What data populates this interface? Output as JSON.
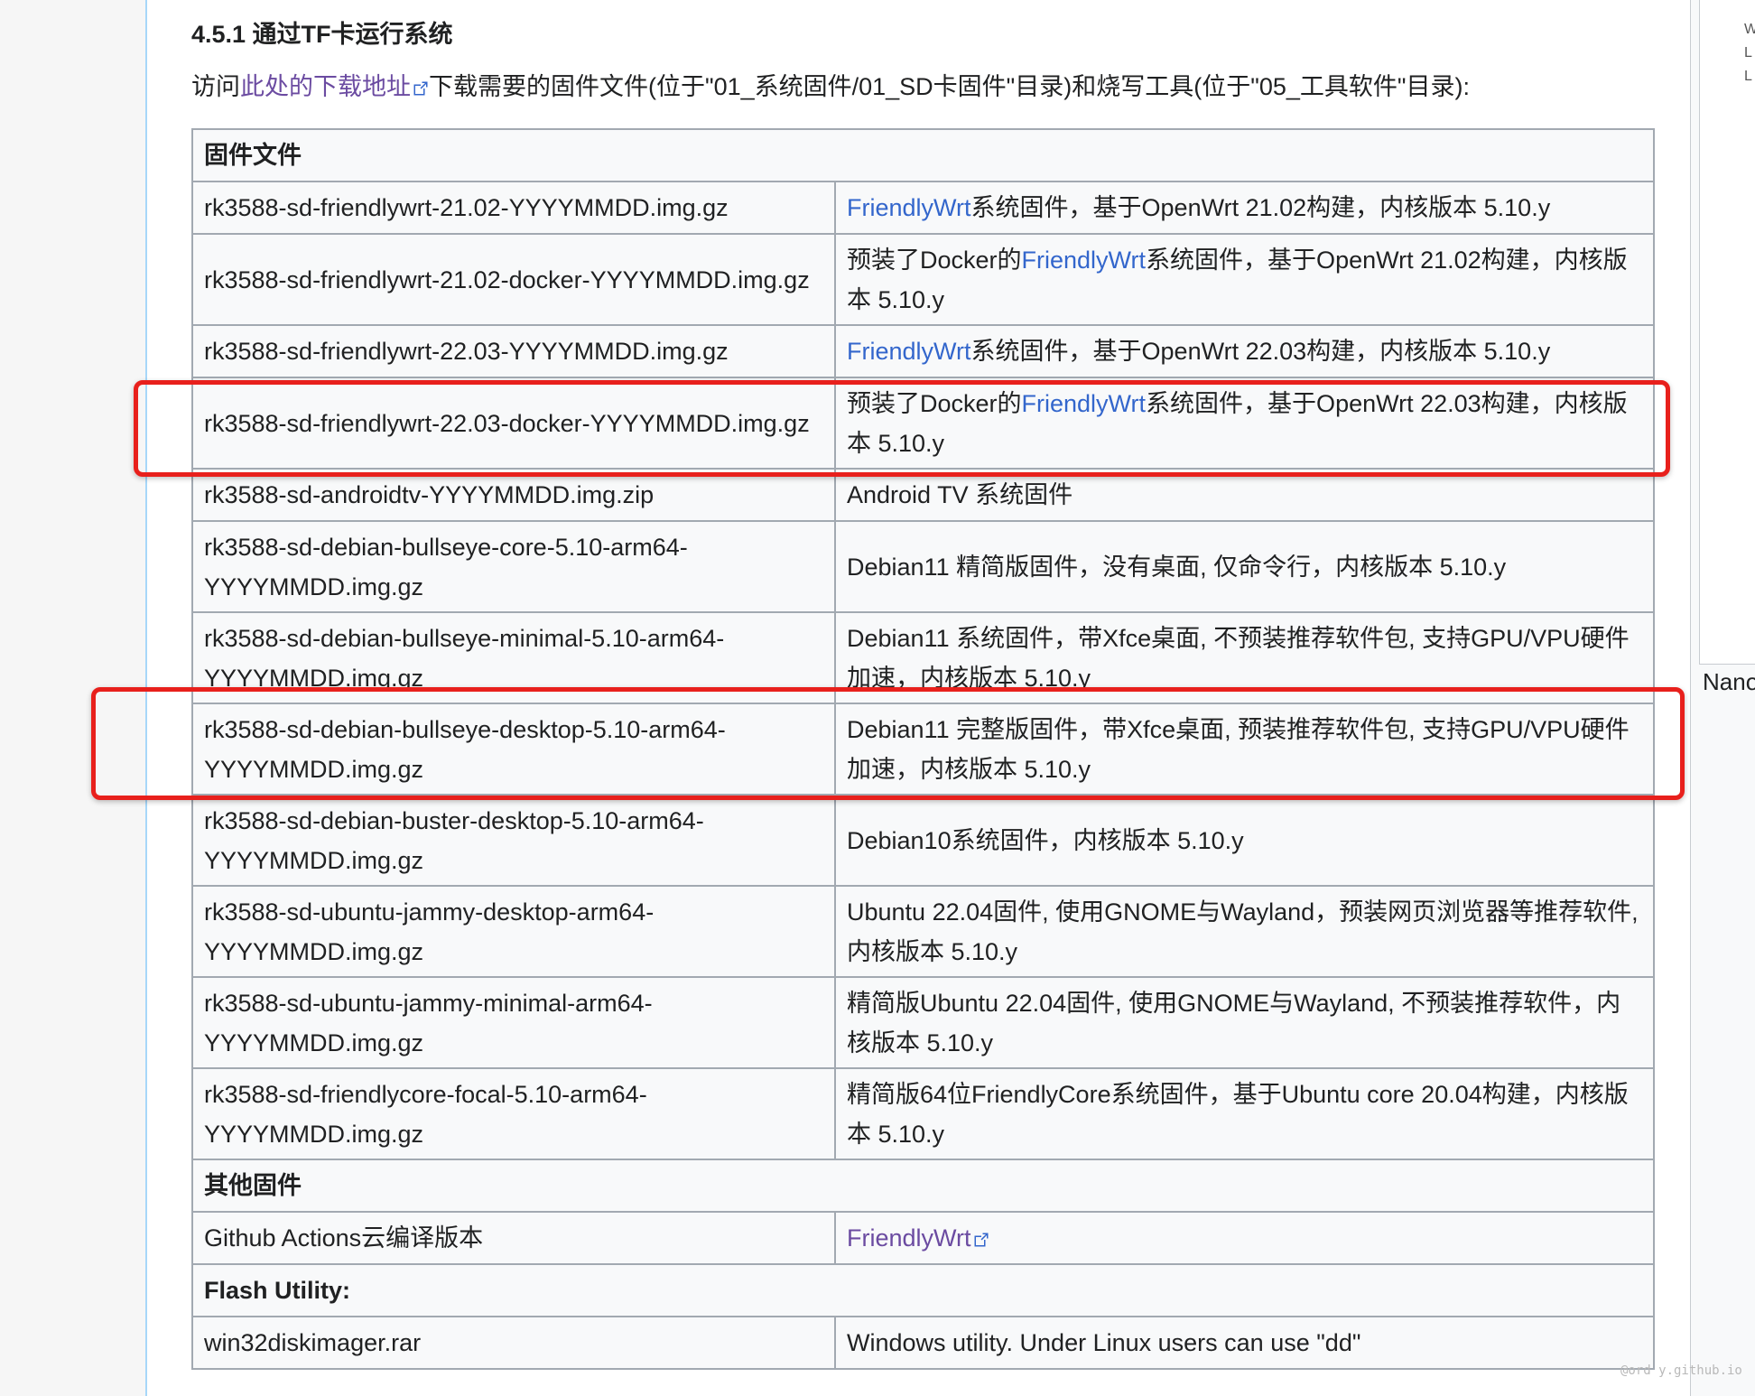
{
  "heading": "4.5.1 通过TF卡运行系统",
  "intro": {
    "prefix": "访问",
    "link": "此处的下载地址",
    "suffix": "下载需要的固件文件(位于\"01_系统固件/01_SD卡固件\"目录)和烧写工具(位于\"05_工具软件\"目录):"
  },
  "table": {
    "section_firmware": "固件文件",
    "rows": [
      {
        "file": "rk3588-sd-friendlywrt-21.02-YYYYMMDD.img.gz",
        "desc_pre": "",
        "desc_link": "FriendlyWrt",
        "desc_post": "系统固件，基于OpenWrt 21.02构建，内核版本 5.10.y"
      },
      {
        "file": "rk3588-sd-friendlywrt-21.02-docker-YYYYMMDD.img.gz",
        "desc_pre": "预装了Docker的",
        "desc_link": "FriendlyWrt",
        "desc_post": "系统固件，基于OpenWrt 21.02构建，内核版本 5.10.y"
      },
      {
        "file": "rk3588-sd-friendlywrt-22.03-YYYYMMDD.img.gz",
        "desc_pre": "",
        "desc_link": "FriendlyWrt",
        "desc_post": "系统固件，基于OpenWrt 22.03构建，内核版本 5.10.y"
      },
      {
        "file": "rk3588-sd-friendlywrt-22.03-docker-YYYYMMDD.img.gz",
        "desc_pre": "预装了Docker的",
        "desc_link": "FriendlyWrt",
        "desc_post": "系统固件，基于OpenWrt 22.03构建，内核版本 5.10.y"
      },
      {
        "file": "rk3588-sd-androidtv-YYYYMMDD.img.zip",
        "desc_pre": "Android TV 系统固件",
        "desc_link": "",
        "desc_post": ""
      },
      {
        "file": "rk3588-sd-debian-bullseye-core-5.10-arm64-YYYYMMDD.img.gz",
        "desc_pre": "Debian11 精简版固件，没有桌面, 仅命令行，内核版本 5.10.y",
        "desc_link": "",
        "desc_post": ""
      },
      {
        "file": "rk3588-sd-debian-bullseye-minimal-5.10-arm64-YYYYMMDD.img.gz",
        "desc_pre": "Debian11 系统固件，带Xfce桌面, 不预装推荐软件包, 支持GPU/VPU硬件加速，内核版本 5.10.y",
        "desc_link": "",
        "desc_post": ""
      },
      {
        "file": "rk3588-sd-debian-bullseye-desktop-5.10-arm64-YYYYMMDD.img.gz",
        "desc_pre": "Debian11 完整版固件，带Xfce桌面, 预装推荐软件包, 支持GPU/VPU硬件加速，内核版本 5.10.y",
        "desc_link": "",
        "desc_post": ""
      },
      {
        "file": "rk3588-sd-debian-buster-desktop-5.10-arm64-YYYYMMDD.img.gz",
        "desc_pre": "Debian10系统固件，内核版本 5.10.y",
        "desc_link": "",
        "desc_post": ""
      },
      {
        "file": "rk3588-sd-ubuntu-jammy-desktop-arm64-YYYYMMDD.img.gz",
        "desc_pre": "Ubuntu 22.04固件, 使用GNOME与Wayland，预装网页浏览器等推荐软件, 内核版本 5.10.y",
        "desc_link": "",
        "desc_post": ""
      },
      {
        "file": "rk3588-sd-ubuntu-jammy-minimal-arm64-YYYYMMDD.img.gz",
        "desc_pre": "精简版Ubuntu 22.04固件, 使用GNOME与Wayland, 不预装推荐软件，内核版本 5.10.y",
        "desc_link": "",
        "desc_post": ""
      },
      {
        "file": "rk3588-sd-friendlycore-focal-5.10-arm64-YYYYMMDD.img.gz",
        "desc_pre": "精简版64位FriendlyCore系统固件，基于Ubuntu core 20.04构建，内核版本 5.10.y",
        "desc_link": "",
        "desc_post": ""
      }
    ],
    "section_other": "其他固件",
    "other_row": {
      "file": "Github Actions云编译版本",
      "link": "FriendlyWrt"
    },
    "section_flash": "Flash Utility:",
    "flash_row": {
      "file": "win32diskimager.rar",
      "desc": "Windows utility. Under Linux users can use \"dd\""
    }
  },
  "right_panel_label": "Nano",
  "right_panel_glyphs": [
    "W",
    "L",
    "L"
  ],
  "watermark": "@ord y.github.io",
  "colors": {
    "link": "#3366cc",
    "visited_link": "#6b4ba1",
    "highlight": "#e8201c",
    "table_border": "#a2a9b1"
  }
}
